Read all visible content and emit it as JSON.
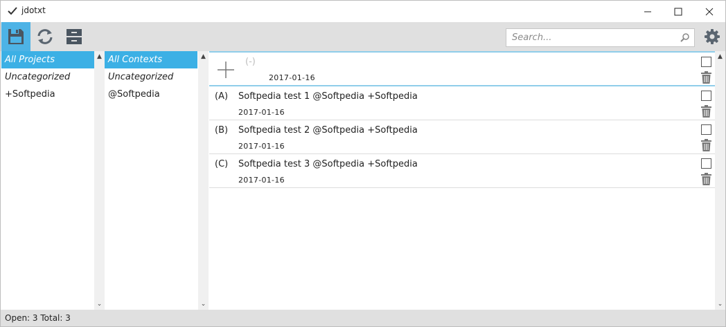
{
  "window": {
    "title": "jdotxt"
  },
  "toolbar": {
    "search_placeholder": "Search..."
  },
  "projects": {
    "items": [
      {
        "label": "All Projects",
        "selected": true,
        "italic": true
      },
      {
        "label": "Uncategorized",
        "selected": false,
        "italic": true
      },
      {
        "label": "+Softpedia",
        "selected": false,
        "italic": false
      }
    ]
  },
  "contexts": {
    "items": [
      {
        "label": "All Contexts",
        "selected": true,
        "italic": true
      },
      {
        "label": "Uncategorized",
        "selected": false,
        "italic": true
      },
      {
        "label": "@Softpedia",
        "selected": false,
        "italic": false
      }
    ]
  },
  "new_task": {
    "priority": "(-)",
    "date": "2017-01-16"
  },
  "tasks": [
    {
      "priority": "(A)",
      "text": "Softpedia test 1 @Softpedia +Softpedia",
      "date": "2017-01-16"
    },
    {
      "priority": "(B)",
      "text": "Softpedia test 2 @Softpedia +Softpedia",
      "date": "2017-01-16"
    },
    {
      "priority": "(C)",
      "text": "Softpedia test 3 @Softpedia +Softpedia",
      "date": "2017-01-16"
    }
  ],
  "status": {
    "text": "Open: 3   Total: 3"
  },
  "colors": {
    "accent": "#3cb0e5",
    "toolbar_bg": "#e0e0e0"
  }
}
